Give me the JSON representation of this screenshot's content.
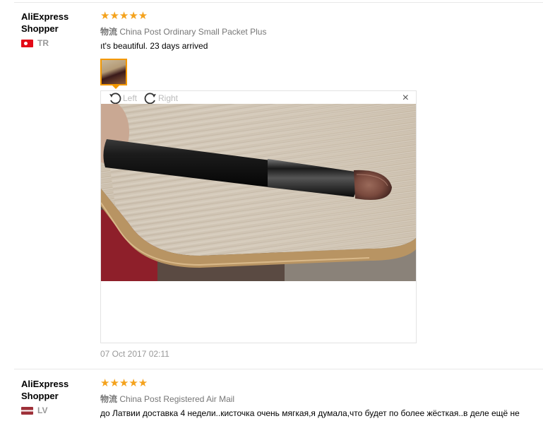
{
  "reviews": [
    {
      "user": [
        "AliExpress",
        "Shopper"
      ],
      "country": "TR",
      "stars": "★★★★★",
      "logistics_tag": "物流",
      "logistics": "China Post Ordinary Small Packet Plus",
      "text": "ıt's beautiful. 23 days arrived",
      "date": "07 Oct 2017 02:11"
    },
    {
      "user": [
        "AliExpress",
        "Shopper"
      ],
      "country": "LV",
      "stars": "★★★★★",
      "logistics_tag": "物流",
      "logistics": "China Post Registered Air Mail",
      "text": "до Латвии доставка 4 недели..кисточка очень мягкая,я думала,что будет по более жёсткая..в деле ещё не"
    }
  ],
  "viewer": {
    "rotate_left": "Left",
    "rotate_right": "Right",
    "close": "×"
  },
  "colors": {
    "accent": "#f39800",
    "stars": "#f4a21c"
  }
}
